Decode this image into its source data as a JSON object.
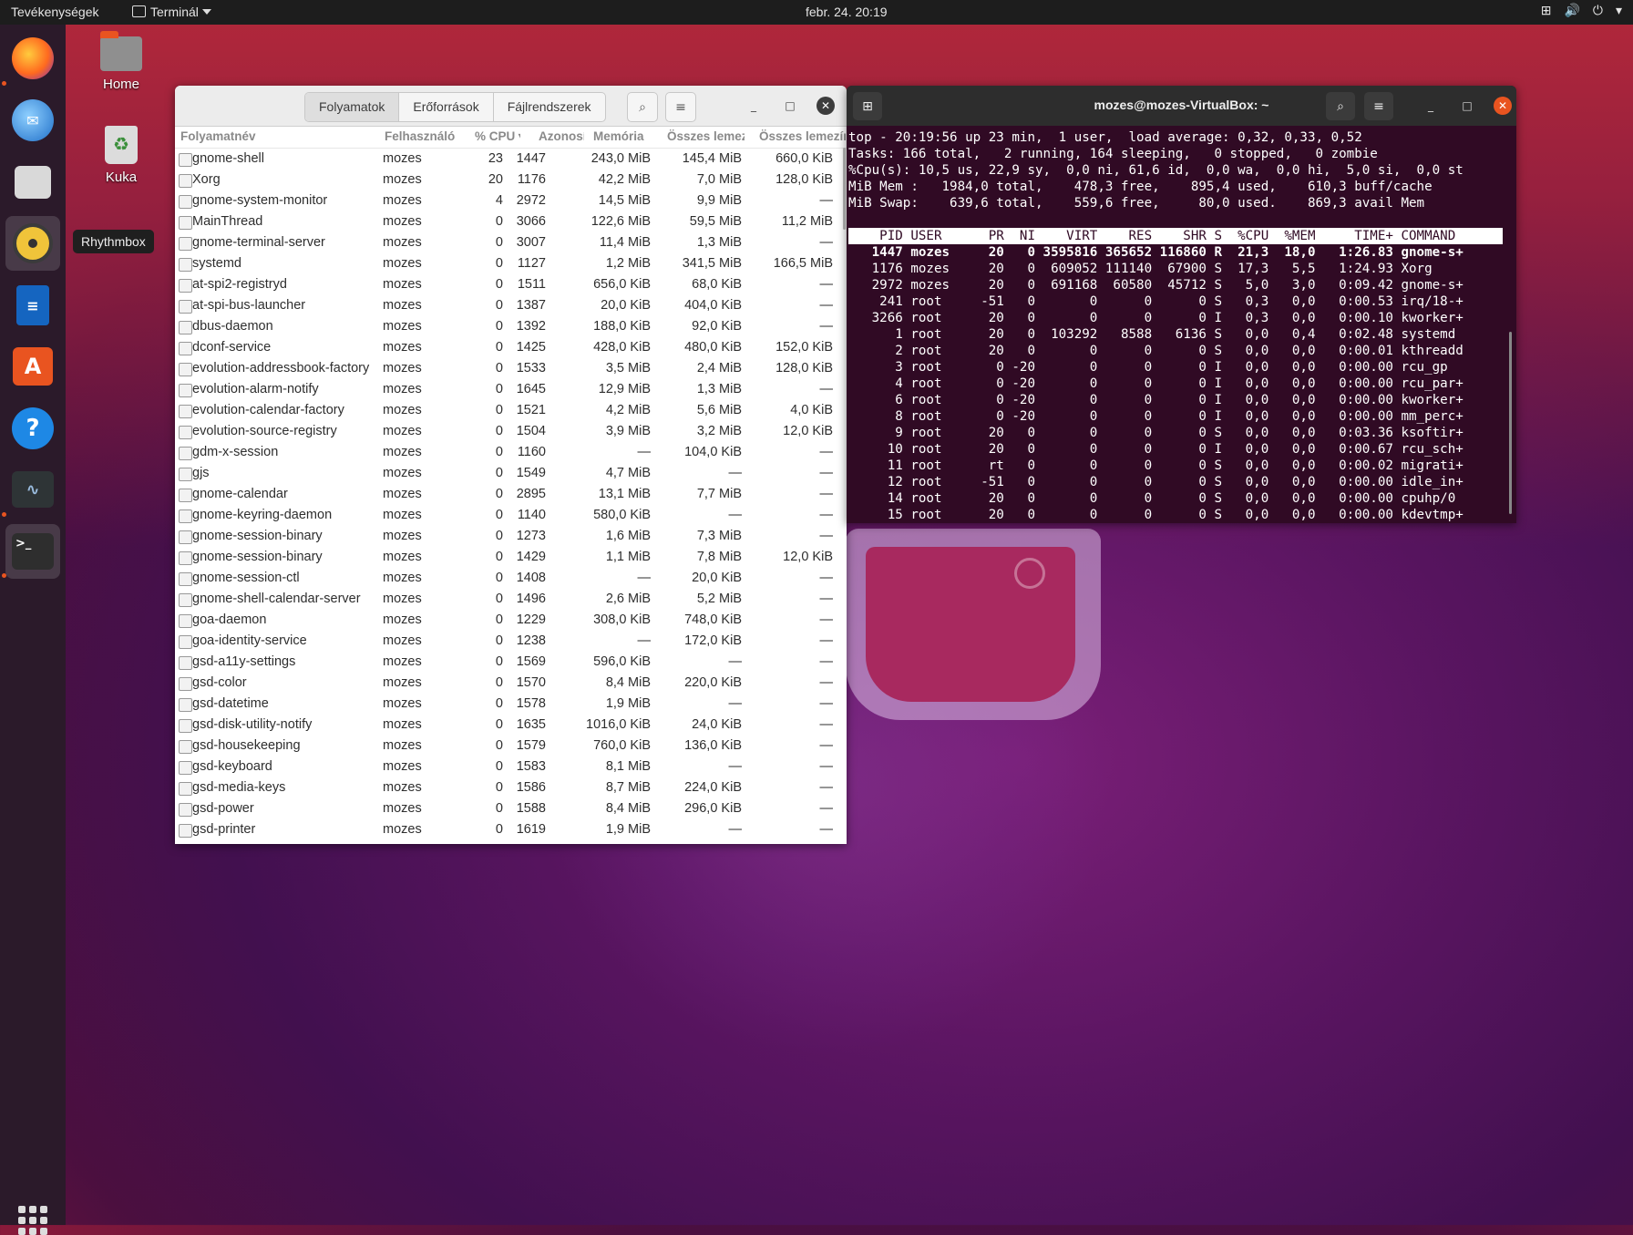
{
  "topbar": {
    "activities": "Tevékenységek",
    "app_name": "Terminál",
    "clock": "febr. 24.  20:19"
  },
  "dock": {
    "tooltip": "Rhythmbox",
    "items": [
      "firefox-icon",
      "thunderbird-icon",
      "files-icon",
      "rhythmbox-icon",
      "writer-icon",
      "software-icon",
      "help-icon",
      "system-monitor-icon",
      "terminal-icon"
    ]
  },
  "desktop": {
    "home_label": "Home",
    "trash_label": "Kuka"
  },
  "sysmon": {
    "tabs": [
      "Folyamatok",
      "Erőforrások",
      "Fájlrendszerek"
    ],
    "columns": {
      "name": "Folyamatnév",
      "user": "Felhasználó",
      "cpu": "% CPU",
      "pid": "Azonosító",
      "mem": "Memória",
      "disk_read": "Összes lemezolvasás",
      "disk_write": "Összes lemezírás"
    },
    "rows": [
      {
        "name": "gnome-shell",
        "user": "mozes",
        "cpu": "23",
        "pid": "1447",
        "mem": "243,0 MiB",
        "disk": "145,4 MiB",
        "diskw": "660,0 KiB"
      },
      {
        "name": "Xorg",
        "user": "mozes",
        "cpu": "20",
        "pid": "1176",
        "mem": "42,2 MiB",
        "disk": "7,0 MiB",
        "diskw": "128,0 KiB"
      },
      {
        "name": "gnome-system-monitor",
        "user": "mozes",
        "cpu": "4",
        "pid": "2972",
        "mem": "14,5 MiB",
        "disk": "9,9 MiB",
        "diskw": "—"
      },
      {
        "name": "MainThread",
        "user": "mozes",
        "cpu": "0",
        "pid": "3066",
        "mem": "122,6 MiB",
        "disk": "59,5 MiB",
        "diskw": "11,2 MiB"
      },
      {
        "name": "gnome-terminal-server",
        "user": "mozes",
        "cpu": "0",
        "pid": "3007",
        "mem": "11,4 MiB",
        "disk": "1,3 MiB",
        "diskw": "—"
      },
      {
        "name": "systemd",
        "user": "mozes",
        "cpu": "0",
        "pid": "1127",
        "mem": "1,2 MiB",
        "disk": "341,5 MiB",
        "diskw": "166,5 MiB"
      },
      {
        "name": "at-spi2-registryd",
        "user": "mozes",
        "cpu": "0",
        "pid": "1511",
        "mem": "656,0 KiB",
        "disk": "68,0 KiB",
        "diskw": "—"
      },
      {
        "name": "at-spi-bus-launcher",
        "user": "mozes",
        "cpu": "0",
        "pid": "1387",
        "mem": "20,0 KiB",
        "disk": "404,0 KiB",
        "diskw": "—"
      },
      {
        "name": "dbus-daemon",
        "user": "mozes",
        "cpu": "0",
        "pid": "1392",
        "mem": "188,0 KiB",
        "disk": "92,0 KiB",
        "diskw": "—"
      },
      {
        "name": "dconf-service",
        "user": "mozes",
        "cpu": "0",
        "pid": "1425",
        "mem": "428,0 KiB",
        "disk": "480,0 KiB",
        "diskw": "152,0 KiB"
      },
      {
        "name": "evolution-addressbook-factory",
        "user": "mozes",
        "cpu": "0",
        "pid": "1533",
        "mem": "3,5 MiB",
        "disk": "2,4 MiB",
        "diskw": "128,0 KiB"
      },
      {
        "name": "evolution-alarm-notify",
        "user": "mozes",
        "cpu": "0",
        "pid": "1645",
        "mem": "12,9 MiB",
        "disk": "1,3 MiB",
        "diskw": "—"
      },
      {
        "name": "evolution-calendar-factory",
        "user": "mozes",
        "cpu": "0",
        "pid": "1521",
        "mem": "4,2 MiB",
        "disk": "5,6 MiB",
        "diskw": "4,0 KiB"
      },
      {
        "name": "evolution-source-registry",
        "user": "mozes",
        "cpu": "0",
        "pid": "1504",
        "mem": "3,9 MiB",
        "disk": "3,2 MiB",
        "diskw": "12,0 KiB"
      },
      {
        "name": "gdm-x-session",
        "user": "mozes",
        "cpu": "0",
        "pid": "1160",
        "mem": "—",
        "disk": "104,0 KiB",
        "diskw": "—"
      },
      {
        "name": "gjs",
        "user": "mozes",
        "cpu": "0",
        "pid": "1549",
        "mem": "4,7 MiB",
        "disk": "—",
        "diskw": "—"
      },
      {
        "name": "gnome-calendar",
        "user": "mozes",
        "cpu": "0",
        "pid": "2895",
        "mem": "13,1 MiB",
        "disk": "7,7 MiB",
        "diskw": "—"
      },
      {
        "name": "gnome-keyring-daemon",
        "user": "mozes",
        "cpu": "0",
        "pid": "1140",
        "mem": "580,0 KiB",
        "disk": "—",
        "diskw": "—"
      },
      {
        "name": "gnome-session-binary",
        "user": "mozes",
        "cpu": "0",
        "pid": "1273",
        "mem": "1,6 MiB",
        "disk": "7,3 MiB",
        "diskw": "—"
      },
      {
        "name": "gnome-session-binary",
        "user": "mozes",
        "cpu": "0",
        "pid": "1429",
        "mem": "1,1 MiB",
        "disk": "7,8 MiB",
        "diskw": "12,0 KiB"
      },
      {
        "name": "gnome-session-ctl",
        "user": "mozes",
        "cpu": "0",
        "pid": "1408",
        "mem": "—",
        "disk": "20,0 KiB",
        "diskw": "—"
      },
      {
        "name": "gnome-shell-calendar-server",
        "user": "mozes",
        "cpu": "0",
        "pid": "1496",
        "mem": "2,6 MiB",
        "disk": "5,2 MiB",
        "diskw": "—"
      },
      {
        "name": "goa-daemon",
        "user": "mozes",
        "cpu": "0",
        "pid": "1229",
        "mem": "308,0 KiB",
        "disk": "748,0 KiB",
        "diskw": "—"
      },
      {
        "name": "goa-identity-service",
        "user": "mozes",
        "cpu": "0",
        "pid": "1238",
        "mem": "—",
        "disk": "172,0 KiB",
        "diskw": "—"
      },
      {
        "name": "gsd-a11y-settings",
        "user": "mozes",
        "cpu": "0",
        "pid": "1569",
        "mem": "596,0 KiB",
        "disk": "—",
        "diskw": "—"
      },
      {
        "name": "gsd-color",
        "user": "mozes",
        "cpu": "0",
        "pid": "1570",
        "mem": "8,4 MiB",
        "disk": "220,0 KiB",
        "diskw": "—"
      },
      {
        "name": "gsd-datetime",
        "user": "mozes",
        "cpu": "0",
        "pid": "1578",
        "mem": "1,9 MiB",
        "disk": "—",
        "diskw": "—"
      },
      {
        "name": "gsd-disk-utility-notify",
        "user": "mozes",
        "cpu": "0",
        "pid": "1635",
        "mem": "1016,0 KiB",
        "disk": "24,0 KiB",
        "diskw": "—"
      },
      {
        "name": "gsd-housekeeping",
        "user": "mozes",
        "cpu": "0",
        "pid": "1579",
        "mem": "760,0 KiB",
        "disk": "136,0 KiB",
        "diskw": "—"
      },
      {
        "name": "gsd-keyboard",
        "user": "mozes",
        "cpu": "0",
        "pid": "1583",
        "mem": "8,1 MiB",
        "disk": "—",
        "diskw": "—"
      },
      {
        "name": "gsd-media-keys",
        "user": "mozes",
        "cpu": "0",
        "pid": "1586",
        "mem": "8,7 MiB",
        "disk": "224,0 KiB",
        "diskw": "—"
      },
      {
        "name": "gsd-power",
        "user": "mozes",
        "cpu": "0",
        "pid": "1588",
        "mem": "8,4 MiB",
        "disk": "296,0 KiB",
        "diskw": "—"
      },
      {
        "name": "gsd-printer",
        "user": "mozes",
        "cpu": "0",
        "pid": "1619",
        "mem": "1,9 MiB",
        "disk": "—",
        "diskw": "—"
      }
    ]
  },
  "terminal": {
    "title": "mozes@mozes-VirtualBox: ~",
    "summary": [
      "top - 20:19:56 up 23 min,  1 user,  load average: 0,32, 0,33, 0,52",
      "Tasks: 166 total,   2 running, 164 sleeping,   0 stopped,   0 zombie",
      "%Cpu(s): 10,5 us, 22,9 sy,  0,0 ni, 61,6 id,  0,0 wa,  0,0 hi,  5,0 si,  0,0 st",
      "MiB Mem :   1984,0 total,    478,3 free,    895,4 used,    610,3 buff/cache",
      "MiB Swap:    639,6 total,    559,6 free,     80,0 used.    869,3 avail Mem"
    ],
    "header": "    PID USER      PR  NI    VIRT    RES    SHR S  %CPU  %MEM     TIME+ COMMAND",
    "processes": [
      "   1447 mozes     20   0 3595816 365652 116860 R  21,3  18,0   1:26.83 gnome-s+",
      "   1176 mozes     20   0  609052 111140  67900 S  17,3   5,5   1:24.93 Xorg",
      "   2972 mozes     20   0  691168  60580  45712 S   5,0   3,0   0:09.42 gnome-s+",
      "    241 root     -51   0       0      0      0 S   0,3   0,0   0:00.53 irq/18-+",
      "   3266 root      20   0       0      0      0 I   0,3   0,0   0:00.10 kworker+",
      "      1 root      20   0  103292   8588   6136 S   0,0   0,4   0:02.48 systemd",
      "      2 root      20   0       0      0      0 S   0,0   0,0   0:00.01 kthreadd",
      "      3 root       0 -20       0      0      0 I   0,0   0,0   0:00.00 rcu_gp",
      "      4 root       0 -20       0      0      0 I   0,0   0,0   0:00.00 rcu_par+",
      "      6 root       0 -20       0      0      0 I   0,0   0,0   0:00.00 kworker+",
      "      8 root       0 -20       0      0      0 I   0,0   0,0   0:00.00 mm_perc+",
      "      9 root      20   0       0      0      0 S   0,0   0,0   0:03.36 ksoftir+",
      "     10 root      20   0       0      0      0 I   0,0   0,0   0:00.67 rcu_sch+",
      "     11 root      rt   0       0      0      0 S   0,0   0,0   0:00.02 migrati+",
      "     12 root     -51   0       0      0      0 S   0,0   0,0   0:00.00 idle_in+",
      "     14 root      20   0       0      0      0 S   0,0   0,0   0:00.00 cpuhp/0",
      "     15 root      20   0       0      0      0 S   0,0   0,0   0:00.00 kdevtmp+"
    ]
  }
}
